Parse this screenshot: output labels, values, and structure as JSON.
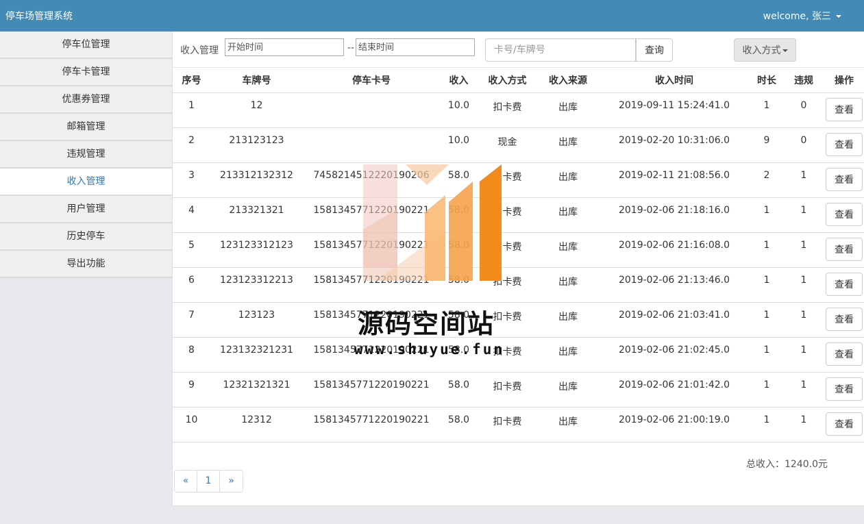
{
  "header": {
    "app_title": "停车场管理系统",
    "welcome": "welcome, 张三"
  },
  "sidebar": {
    "items": [
      {
        "label": "停车位管理"
      },
      {
        "label": "停车卡管理"
      },
      {
        "label": "优惠券管理"
      },
      {
        "label": "邮箱管理"
      },
      {
        "label": "违规管理"
      },
      {
        "label": "收入管理",
        "active": true
      },
      {
        "label": "用户管理"
      },
      {
        "label": "历史停车"
      },
      {
        "label": "导出功能"
      }
    ]
  },
  "toolbar": {
    "label": "收入管理",
    "start_placeholder": "开始时间",
    "separator": "--",
    "end_placeholder": "结束时间",
    "search_placeholder": "卡号/车牌号",
    "search_button": "查询",
    "method_button": "收入方式"
  },
  "table": {
    "headers": [
      "序号",
      "车牌号",
      "停车卡号",
      "收入",
      "收入方式",
      "收入来源",
      "收入时间",
      "时长",
      "违规",
      "操作"
    ],
    "action_label": "查看",
    "rows": [
      [
        "1",
        "12",
        "",
        "10.0",
        "扣卡费",
        "出库",
        "2019-09-11 15:24:41.0",
        "1",
        "0"
      ],
      [
        "2",
        "213123123",
        "",
        "10.0",
        "现金",
        "出库",
        "2019-02-20 10:31:06.0",
        "9",
        "0"
      ],
      [
        "3",
        "213312132312",
        "7458214512220190206",
        "58.0",
        "扣卡费",
        "出库",
        "2019-02-11 21:08:56.0",
        "2",
        "1"
      ],
      [
        "4",
        "213321321",
        "1581345771220190221",
        "58.0",
        "扣卡费",
        "出库",
        "2019-02-06 21:18:16.0",
        "1",
        "1"
      ],
      [
        "5",
        "123123312123",
        "1581345771220190221",
        "58.0",
        "扣卡费",
        "出库",
        "2019-02-06 21:16:08.0",
        "1",
        "1"
      ],
      [
        "6",
        "123123312213",
        "1581345771220190221",
        "58.0",
        "扣卡费",
        "出库",
        "2019-02-06 21:13:46.0",
        "1",
        "1"
      ],
      [
        "7",
        "123123",
        "1581345771220190221",
        "58.0",
        "扣卡费",
        "出库",
        "2019-02-06 21:03:41.0",
        "1",
        "1"
      ],
      [
        "8",
        "123132321231",
        "1581345771220190221",
        "58.0",
        "扣卡费",
        "出库",
        "2019-02-06 21:02:45.0",
        "1",
        "1"
      ],
      [
        "9",
        "12321321321",
        "1581345771220190221",
        "58.0",
        "扣卡费",
        "出库",
        "2019-02-06 21:01:42.0",
        "1",
        "1"
      ],
      [
        "10",
        "12312",
        "1581345771220190221",
        "58.0",
        "扣卡费",
        "出库",
        "2019-02-06 21:00:19.0",
        "1",
        "1"
      ]
    ]
  },
  "summary": {
    "total": "总收入：1240.0元"
  },
  "pagination": {
    "prev": "«",
    "page": "1",
    "next": "»"
  },
  "watermark": {
    "text": "源码空间站",
    "url": "www.shuyue.fun"
  },
  "colors": {
    "header": "#428bb6",
    "link": "#337ab7",
    "watermark_orange": "#f28a1c"
  }
}
